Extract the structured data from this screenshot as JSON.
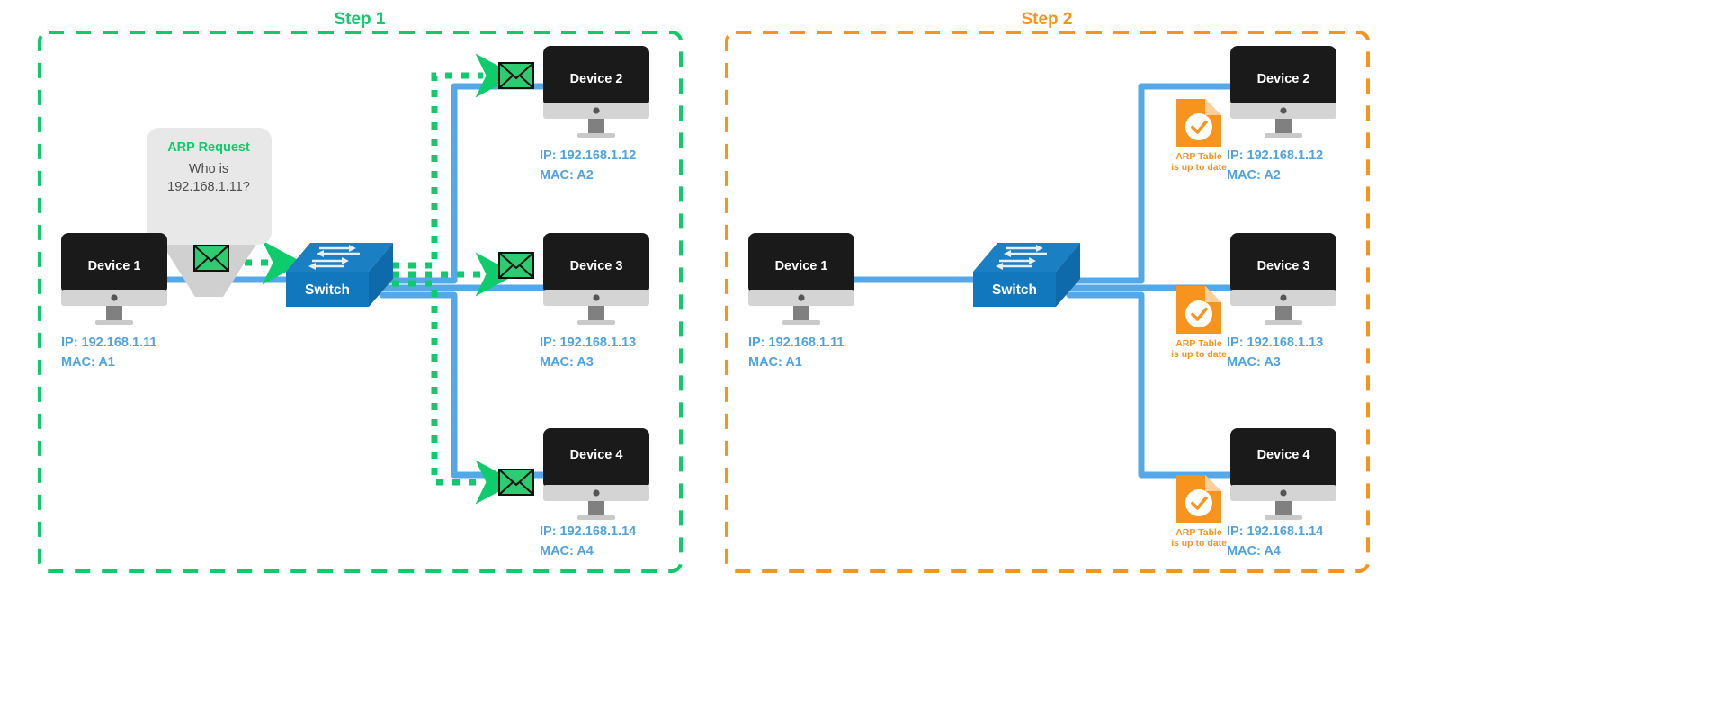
{
  "diagram": {
    "title_hidden": "ARP broadcast and ARP table update",
    "colors": {
      "step1_accent": "#0ECB6B",
      "step2_accent": "#F7941E",
      "link_blue": "#55A8E8",
      "label_blue": "#4FA3E3",
      "switch_blue": "#1278BE",
      "switch_top_blue": "#1B7FC4",
      "monitor_screen": "#1A1A1A",
      "monitor_bezel": "#D4D4D4",
      "monitor_stand": "#808080",
      "bubble_fill": "#E8E8E8",
      "bubble_funnel": "#D0D0D0",
      "envelope_green": "#2ECC71",
      "bubble_text": "#4D4D4D"
    },
    "panels": [
      {
        "id": "step1",
        "title": "Step 1",
        "accent": "#0ECB6B",
        "border_style": "dashed",
        "bubble": {
          "heading": "ARP Request",
          "line1": "Who is",
          "line2": "192.168.1.11?"
        },
        "switch": {
          "label": "Switch"
        },
        "devices": [
          {
            "name": "Device 1",
            "ip": "IP: 192.168.1.11",
            "mac": "MAC: A1",
            "has_envelope": false
          },
          {
            "name": "Device 2",
            "ip": "IP: 192.168.1.12",
            "mac": "MAC: A2",
            "has_envelope": true
          },
          {
            "name": "Device 3",
            "ip": "IP: 192.168.1.13",
            "mac": "MAC: A3",
            "has_envelope": true
          },
          {
            "name": "Device 4",
            "ip": "IP: 192.168.1.14",
            "mac": "MAC: A4",
            "has_envelope": true
          }
        ]
      },
      {
        "id": "step2",
        "title": "Step 2",
        "accent": "#F7941E",
        "border_style": "dashed",
        "switch": {
          "label": "Switch"
        },
        "arp_note": {
          "line1": "ARP Table",
          "line2": "is up to date"
        },
        "devices": [
          {
            "name": "Device 1",
            "ip": "IP: 192.168.1.11",
            "mac": "MAC: A1",
            "has_arp_note": false
          },
          {
            "name": "Device 2",
            "ip": "IP: 192.168.1.12",
            "mac": "MAC: A2",
            "has_arp_note": true
          },
          {
            "name": "Device 3",
            "ip": "IP: 192.168.1.13",
            "mac": "MAC: A3",
            "has_arp_note": true
          },
          {
            "name": "Device 4",
            "ip": "IP: 192.168.1.14",
            "mac": "MAC: A4",
            "has_arp_note": true
          }
        ]
      }
    ],
    "icons": {
      "envelope": "envelope-icon",
      "arp_document": "document-check-icon",
      "switch": "network-switch-icon",
      "monitor": "desktop-monitor-icon",
      "arrow": "arrow-right-icon"
    }
  }
}
